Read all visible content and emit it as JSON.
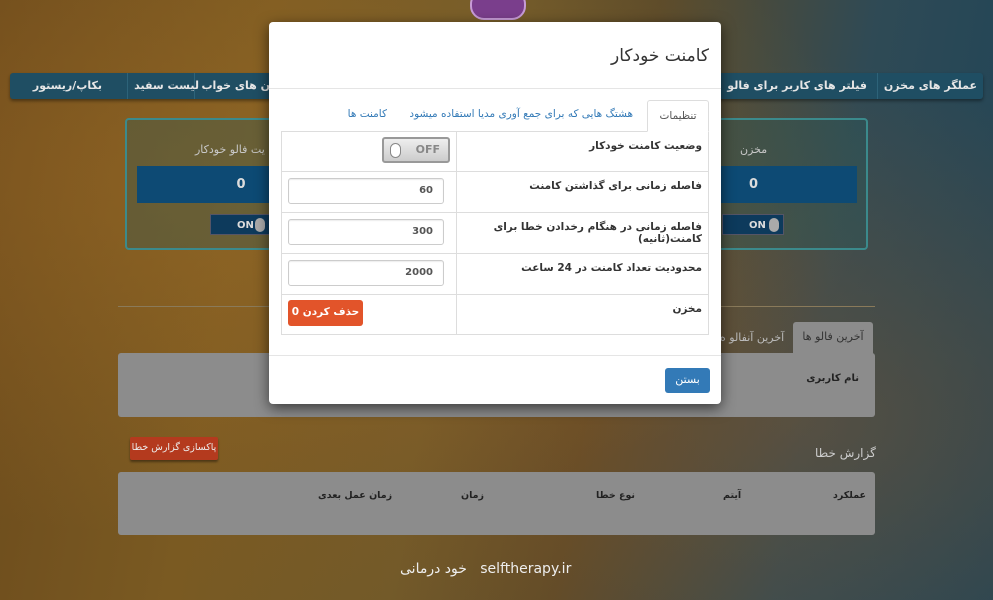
{
  "nav": {
    "items": [
      "عملگر های مخزن",
      "فیلتر های کاربر برای فالو",
      "ن های خواب",
      "لیست سفید",
      "بکاپ/ریستور"
    ]
  },
  "stats": {
    "left_label": "یت فالو خودکار",
    "left_value": "0",
    "left_toggle": "ON",
    "right_label": "مخزن",
    "right_value": "0",
    "right_toggle": "ON"
  },
  "tabs": {
    "active": "آخرین فالو ها",
    "second": "آخرین آنفالو ه"
  },
  "follows": {
    "column": "نام کاربری"
  },
  "errors": {
    "title": "گزارش خطا",
    "clear_button": "پاکسازی گزارش خطا",
    "columns": [
      "عملکرد",
      "آیتم",
      "نوع خطا",
      "زمان",
      "زمان عمل بعدی"
    ]
  },
  "footer": {
    "site": "selftherapy.ir",
    "brand": "خود درمانی"
  },
  "modal": {
    "title": "کامنت خودکار",
    "tabs": [
      "تنظیمات",
      "هشتگ هایی که برای جمع آوری مدیا استفاده میشود",
      "کامنت ها"
    ],
    "rows": [
      {
        "label": "وضعیت کامنت خودکار",
        "toggle": "OFF"
      },
      {
        "label": "فاصله زمانی برای گذاشتن کامنت",
        "value": "60"
      },
      {
        "label": "فاصله زمانی در هنگام رخدادن خطا برای کامنت(ثانیه)",
        "value": "300"
      },
      {
        "label": "محدودیت تعداد کامنت در 24 ساعت",
        "value": "2000"
      },
      {
        "label": "مخزن",
        "button": "حذف کردن 0"
      }
    ],
    "close": "بستن"
  },
  "colors": {
    "accent": "#337ab7",
    "danger": "#e2542a",
    "nav": "#1f4e63"
  }
}
